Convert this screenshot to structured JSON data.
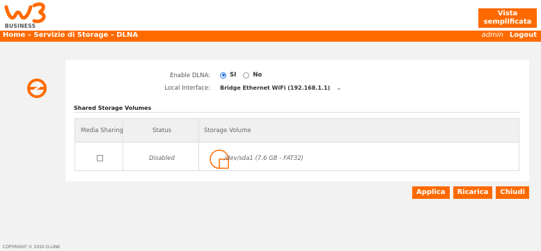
{
  "header": {
    "logo_text": "BUSINESS",
    "vista_button": "Vista semplificata"
  },
  "nav": {
    "breadcrumb": "Home – Servizio di Storage – DLNA",
    "user": "admin",
    "logout": "Logout"
  },
  "form": {
    "enable_dlna_label": "Enable DLNA:",
    "radio_yes": "SI",
    "radio_no": "No",
    "selected": "SI",
    "local_interface_label": "Local Interface:",
    "local_interface_value": "Bridge Ethernet WiFi (192.168.1.1)"
  },
  "shared": {
    "title": "Shared Storage Volumes",
    "columns": [
      "Media Sharing",
      "Status",
      "Storage Volume"
    ],
    "rows": [
      {
        "media_sharing": false,
        "status": "Disabled",
        "volume": "/dev/sda1 (7.6 GB - FAT32)"
      }
    ]
  },
  "actions": {
    "apply": "Applica",
    "reload": "Ricarica",
    "close": "Chiudi"
  },
  "footer": {
    "copyright": "COPYRIGHT © 2020 D-LINK"
  },
  "colors": {
    "accent": "#ff6a00",
    "radio": "#1a6fe0"
  }
}
